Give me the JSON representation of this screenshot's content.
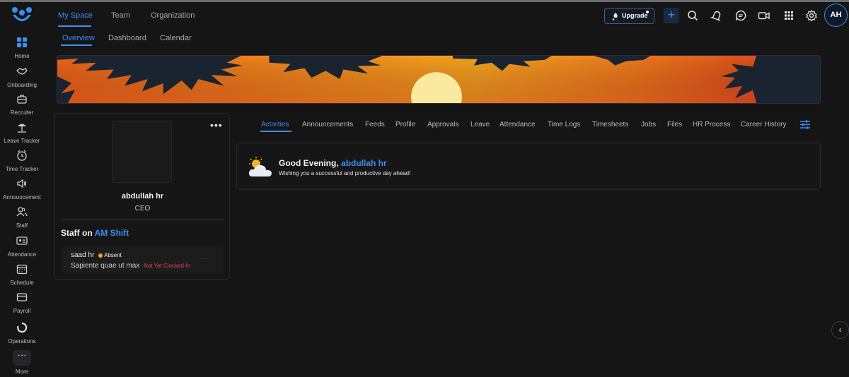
{
  "sidebar": {
    "items": [
      {
        "label": "Home",
        "icon": "grid-icon"
      },
      {
        "label": "Onboarding",
        "icon": "handshake-icon"
      },
      {
        "label": "Recruiter",
        "icon": "briefcase-icon"
      },
      {
        "label": "Leave Tracker",
        "icon": "beach-umbrella-icon"
      },
      {
        "label": "Time Tracker",
        "icon": "clock-icon"
      },
      {
        "label": "Announcement",
        "icon": "megaphone-icon"
      },
      {
        "label": "Staff",
        "icon": "people-icon"
      },
      {
        "label": "Attendance",
        "icon": "id-card-icon"
      },
      {
        "label": "Schedule",
        "icon": "calendar-icon"
      },
      {
        "label": "Payroll",
        "icon": "wallet-icon"
      },
      {
        "label": "Operations",
        "icon": "circle-refresh-icon"
      },
      {
        "label": "More",
        "icon": "more-dots-icon"
      }
    ]
  },
  "topnav": {
    "tabs": [
      "My Space",
      "Team",
      "Organization"
    ],
    "active": "My Space"
  },
  "subnav": {
    "tabs": [
      "Overview",
      "Dashboard",
      "Calendar"
    ],
    "active": "Overview"
  },
  "header": {
    "upgrade_label": "Upgrade",
    "plus_label": "+",
    "avatar_initials": "AH"
  },
  "profile": {
    "name": "abdullah hr",
    "role": "CEO",
    "more": "•••",
    "shift_prefix": "Staff on ",
    "shift_name": "AM Shift",
    "staff": [
      {
        "name": "saad hr",
        "status": "Absent",
        "job": "Sapiente quae ut max",
        "clock": "Not Yet Clocked-In",
        "more": "···"
      }
    ]
  },
  "tabs": {
    "items": [
      "Activities",
      "Announcements",
      "Feeds",
      "Profile",
      "Approvals",
      "Leave",
      "Attendance",
      "Time Logs",
      "Timesheets",
      "Jobs",
      "Files",
      "HR Process",
      "Career History"
    ],
    "active": "Activities"
  },
  "greeting": {
    "prefix": "Good Evening, ",
    "name": "abdullah hr",
    "message": "Wishing you a successful and productive day ahead!"
  },
  "colors": {
    "accent": "#3b8ff2",
    "background": "#151516",
    "absent": "#f0a21c",
    "alert": "#e5484d"
  }
}
